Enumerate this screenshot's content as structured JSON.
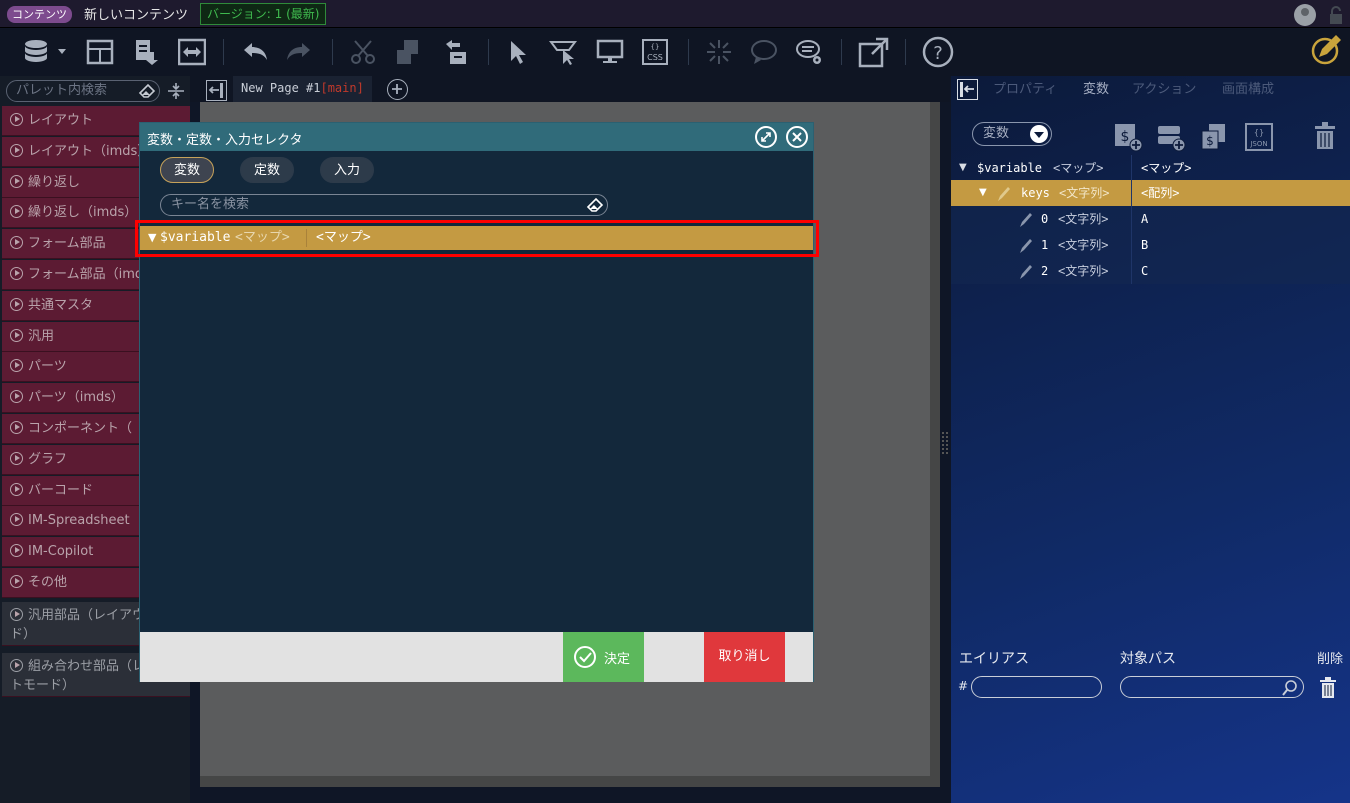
{
  "topbar": {
    "tag": "コンテンツ",
    "title": "新しいコンテンツ",
    "version": "バージョン: 1 (最新)"
  },
  "toolbar": {
    "icons": [
      "database-icon",
      "layout-icon",
      "download-icon",
      "split-icon",
      "undo-icon",
      "redo-icon",
      "cut-icon",
      "copy-icon",
      "paste-icon",
      "pointer-icon",
      "select-icon",
      "monitor-icon",
      "css-icon",
      "spark-icon",
      "comment-icon",
      "comment-settings-icon",
      "external-icon",
      "help-icon",
      "edit-icon"
    ]
  },
  "palette": {
    "search_placeholder": "パレット内検索",
    "items": [
      "レイアウト",
      "レイアウト（imds）",
      "繰り返し",
      "繰り返し（imds）",
      "フォーム部品",
      "フォーム部品（imds）",
      "共通マスタ",
      "汎用",
      "パーツ",
      "パーツ（imds）",
      "コンポーネント（",
      "グラフ",
      "バーコード",
      "IM-Spreadsheet",
      "IM-Copilot",
      "その他"
    ],
    "gray_items": [
      "汎用部品（レイアウトモード）",
      "組み合わせ部品（レイアウトモード）"
    ]
  },
  "page_tab": {
    "name": "New Page #1",
    "branch": "[main]"
  },
  "right_panel": {
    "tabs": [
      "プロパティ",
      "変数",
      "アクション",
      "画面構成"
    ],
    "active_tab": "変数",
    "type_select": "変数",
    "tree": [
      {
        "name": "$variable",
        "type": "<マップ>",
        "value": "<マップ>"
      },
      {
        "name": "keys",
        "type": "<文字列>",
        "value": "<配列>"
      },
      {
        "name": "0",
        "type": "<文字列>",
        "value": "A"
      },
      {
        "name": "1",
        "type": "<文字列>",
        "value": "B"
      },
      {
        "name": "2",
        "type": "<文字列>",
        "value": "C"
      }
    ],
    "alias_header": "エイリアス",
    "path_header": "対象パス",
    "delete_header": "削除",
    "hash": "#"
  },
  "modal": {
    "title": "変数・定数・入力セレクタ",
    "tabs": [
      "変数",
      "定数",
      "入力"
    ],
    "search_placeholder": "キー名を検索",
    "row": {
      "name": "$variable",
      "type": "<マップ>",
      "value": "<マップ>"
    },
    "ok_label": "決定",
    "cancel_label": "取り消し"
  },
  "colors": {
    "selected_row": "#c49a42",
    "ok": "#5cb85c",
    "cancel": "#e0383c",
    "highlight_border": "#ff0000"
  }
}
